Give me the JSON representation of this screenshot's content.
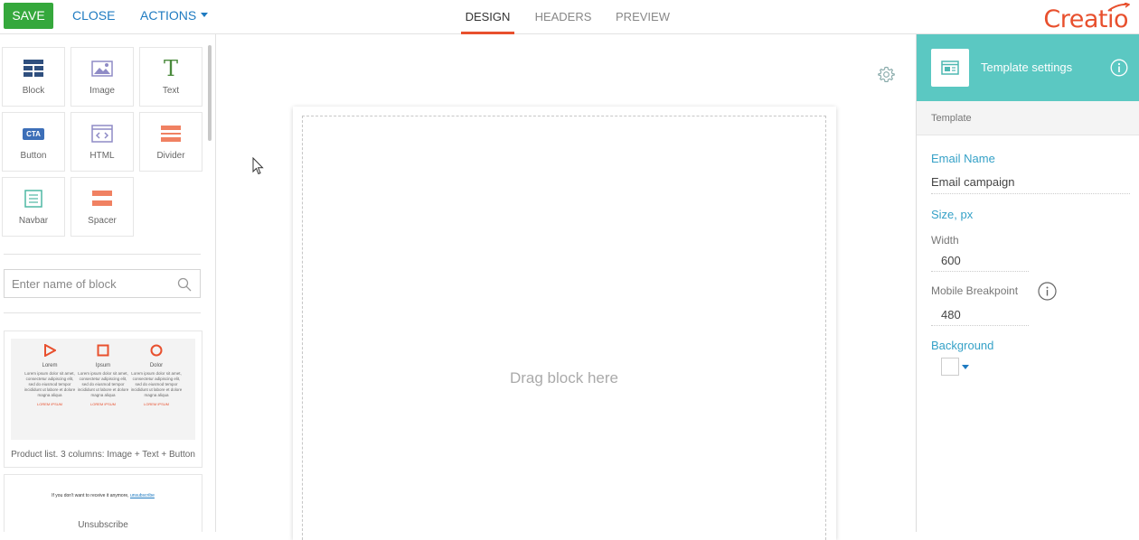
{
  "toolbar": {
    "save_label": "SAVE",
    "close_label": "CLOSE",
    "actions_label": "ACTIONS"
  },
  "tabs": [
    {
      "label": "DESIGN",
      "active": true
    },
    {
      "label": "HEADERS",
      "active": false
    },
    {
      "label": "PREVIEW",
      "active": false
    }
  ],
  "brand": {
    "logo_text": "Creatio",
    "accent_color": "#e8502e"
  },
  "blocks": [
    {
      "label": "Block",
      "icon": "block-icon"
    },
    {
      "label": "Image",
      "icon": "image-icon"
    },
    {
      "label": "Text",
      "icon": "text-icon"
    },
    {
      "label": "Button",
      "icon": "cta-button-icon"
    },
    {
      "label": "HTML",
      "icon": "html-icon"
    },
    {
      "label": "Divider",
      "icon": "divider-icon"
    },
    {
      "label": "Navbar",
      "icon": "navbar-icon"
    },
    {
      "label": "Spacer",
      "icon": "spacer-icon"
    }
  ],
  "cta_icon_text": "CTA",
  "text_icon_glyph": "T",
  "search": {
    "placeholder": "Enter name of block"
  },
  "library": {
    "product_list": {
      "caption": "Product list. 3 columns: Image + Text + Button",
      "columns": [
        {
          "name": "Lorem",
          "icon": "play-triangle-icon",
          "text": "Lorem ipsum dolor sit amet, consectetur adipiscing elit, sed do eiusmod tempor incididunt ut labore et dolore magna aliqua",
          "button": "LOREM IPSUM"
        },
        {
          "name": "Ipsum",
          "icon": "square-icon",
          "text": "Lorem ipsum dolor sit amet, consectetur adipiscing elit, sed do eiusmod tempor incididunt ut labore et dolore magna aliqua",
          "button": "LOREM IPSUM"
        },
        {
          "name": "Dolor",
          "icon": "circle-icon",
          "text": "Lorem ipsum dolor sit amet, consectetur adipiscing elit, sed do eiusmod tempor incididunt ut labore et dolore magna aliqua",
          "button": "LOREM IPSUM"
        }
      ]
    },
    "unsubscribe": {
      "caption": "Unsubscribe",
      "line_text": "If you don't want to receive it anymore,",
      "link_text": "unsubscribe"
    }
  },
  "canvas": {
    "drop_hint": "Drag block here"
  },
  "settings": {
    "header_title": "Template settings",
    "section_title": "Template",
    "email_name_label": "Email Name",
    "email_name_value": "Email campaign",
    "size_label": "Size, px",
    "width_label": "Width",
    "width_value": "600",
    "breakpoint_label": "Mobile Breakpoint",
    "breakpoint_value": "480",
    "background_label": "Background",
    "header_color": "#5bc8c2",
    "label_color": "#35a1c7"
  }
}
